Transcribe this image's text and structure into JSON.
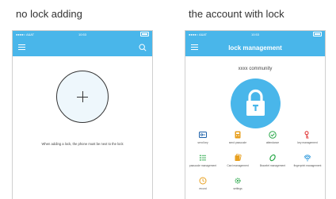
{
  "captions": {
    "left": "no lock adding",
    "right": "the account with lock"
  },
  "status_bar": {
    "carrier": "●●●●○ A&AT",
    "time": "10:53"
  },
  "left_screen": {
    "hint": "When adding a lock, the phone must be next to the lock",
    "add_symbol": "+"
  },
  "right_screen": {
    "title": "lock management",
    "community": "xxxx community",
    "functions": [
      {
        "label": "send key",
        "icon": "key-card-icon",
        "color": "#1a5fa8"
      },
      {
        "label": "send passcode",
        "icon": "passcode-icon",
        "color": "#e8a020"
      },
      {
        "label": "attendance",
        "icon": "check-circle-icon",
        "color": "#2aa84a"
      },
      {
        "label": "key management",
        "icon": "key-management-icon",
        "color": "#e03030"
      },
      {
        "label": "passcode management",
        "icon": "list-icon",
        "color": "#2aa84a"
      },
      {
        "label": "Card management",
        "icon": "card-stack-icon",
        "color": "#e8a020"
      },
      {
        "label": "Bracelet management",
        "icon": "bracelet-icon",
        "color": "#2aa84a"
      },
      {
        "label": "fingerprint management",
        "icon": "fingerprint-icon",
        "color": "#1a8fd8"
      },
      {
        "label": "record",
        "icon": "record-clock-icon",
        "color": "#e8a020"
      },
      {
        "label": "settings",
        "icon": "settings-gear-icon",
        "color": "#2aa84a"
      }
    ]
  },
  "colors": {
    "accent": "#49b6ea",
    "circle_fill": "#eef7fc"
  }
}
